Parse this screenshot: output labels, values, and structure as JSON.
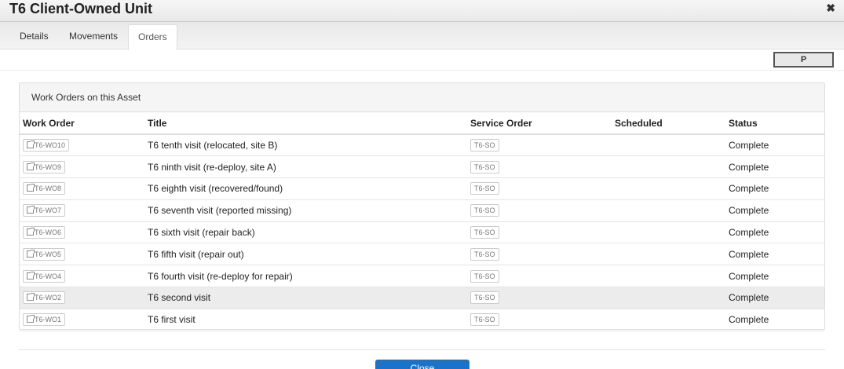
{
  "dialog": {
    "title": "T6 Client-Owned Unit",
    "close_glyph": "✖"
  },
  "tabs": [
    "Details",
    "Movements",
    "Orders"
  ],
  "toolbar": {
    "p_label": "P"
  },
  "panel": {
    "heading": "Work Orders on this Asset"
  },
  "table": {
    "columns": [
      "Work Order",
      "Title",
      "Service Order",
      "Scheduled",
      "Status"
    ],
    "rows": [
      {
        "wo": "T6-WO10",
        "title": "T6 tenth visit (relocated, site B)",
        "so": "T6-SO",
        "scheduled": "",
        "status": "Complete"
      },
      {
        "wo": "T6-WO9",
        "title": "T6 ninth visit (re-deploy, site A)",
        "so": "T6-SO",
        "scheduled": "",
        "status": "Complete"
      },
      {
        "wo": "T6-WO8",
        "title": "T6 eighth visit (recovered/found)",
        "so": "T6-SO",
        "scheduled": "",
        "status": "Complete"
      },
      {
        "wo": "T6-WO7",
        "title": "T6 seventh visit (reported missing)",
        "so": "T6-SO",
        "scheduled": "",
        "status": "Complete"
      },
      {
        "wo": "T6-WO6",
        "title": "T6 sixth visit (repair back)",
        "so": "T6-SO",
        "scheduled": "",
        "status": "Complete"
      },
      {
        "wo": "T6-WO5",
        "title": "T6 fifth visit (repair out)",
        "so": "T6-SO",
        "scheduled": "",
        "status": "Complete"
      },
      {
        "wo": "T6-WO4",
        "title": "T6 fourth visit (re-deploy for repair)",
        "so": "T6-SO",
        "scheduled": "",
        "status": "Complete"
      },
      {
        "wo": "T6-WO2",
        "title": "T6 second visit",
        "so": "T6-SO",
        "scheduled": "",
        "status": "Complete"
      },
      {
        "wo": "T6-WO1",
        "title": "T6 first visit",
        "so": "T6-SO",
        "scheduled": "",
        "status": "Complete"
      }
    ]
  },
  "footer": {
    "close_label": "Close"
  },
  "colors": {
    "primary_button": "#1a73c8",
    "highlight_row": "#ececec"
  }
}
